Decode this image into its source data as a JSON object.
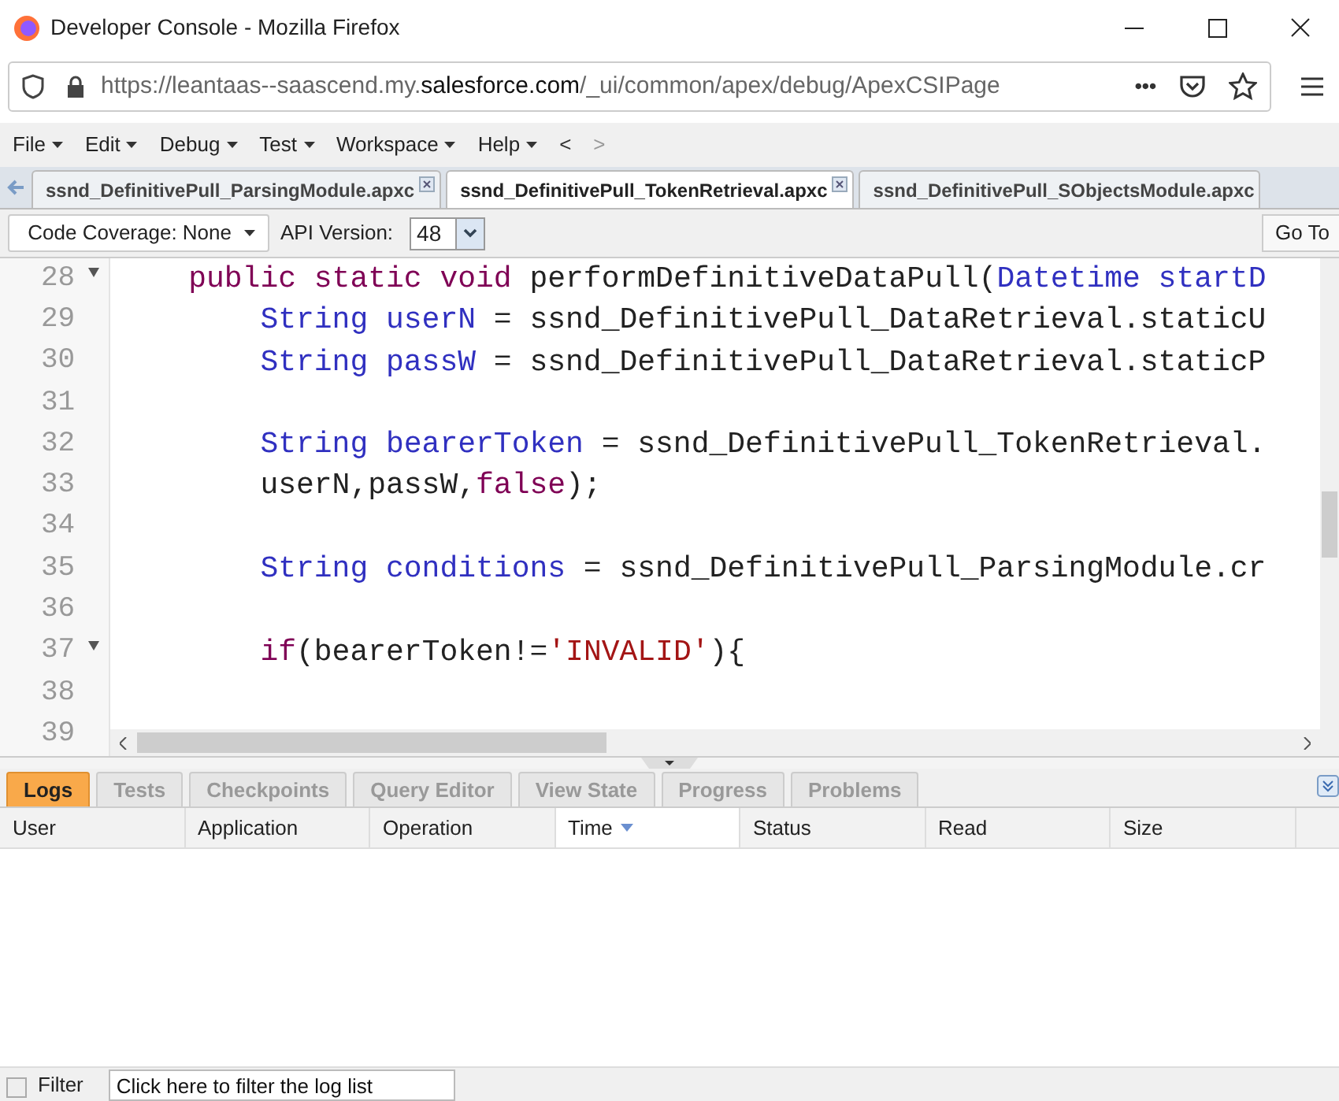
{
  "window": {
    "title": "Developer Console - Mozilla Firefox"
  },
  "address_bar": {
    "url_prefix": "https://leantaas--saascend.my.",
    "url_domain": "salesforce.com",
    "url_path": "/_ui/common/apex/debug/ApexCSIPage",
    "more": "•••"
  },
  "menu": [
    {
      "label": "File"
    },
    {
      "label": "Edit"
    },
    {
      "label": "Debug"
    },
    {
      "label": "Test"
    },
    {
      "label": "Workspace"
    },
    {
      "label": "Help"
    }
  ],
  "nav": [
    "<",
    ">"
  ],
  "file_tabs": [
    {
      "label": "ssnd_DefinitivePull_ParsingModule.apxc",
      "selected": false,
      "closable": true
    },
    {
      "label": "ssnd_DefinitivePull_TokenRetrieval.apxc",
      "selected": true,
      "closable": true
    },
    {
      "label": "ssnd_DefinitivePull_SObjectsModule.apxc",
      "selected": false,
      "closable": false
    }
  ],
  "toolbar": {
    "coverage": "Code Coverage: None",
    "api_label": "API Version:",
    "api_value": "48",
    "goto": "Go To"
  },
  "code_lines": [
    {
      "number": "28",
      "fold": true,
      "kind": "member",
      "tokens": [
        {
          "kind": "keyword",
          "text": "public static void"
        },
        {
          "kind": "plain",
          "text": " performDefinitiveDataPull("
        },
        {
          "kind": "type",
          "text": "Datetime startD"
        }
      ]
    },
    {
      "number": "29",
      "fold": false,
      "kind": "body",
      "tokens": [
        {
          "kind": "type",
          "text": "String userN"
        },
        {
          "kind": "plain",
          "text": " = ssnd_DefinitivePull_DataRetrieval.staticU"
        }
      ]
    },
    {
      "number": "30",
      "fold": false,
      "kind": "body",
      "tokens": [
        {
          "kind": "type",
          "text": "String passW"
        },
        {
          "kind": "plain",
          "text": " = ssnd_DefinitivePull_DataRetrieval.staticP"
        }
      ]
    },
    {
      "number": "31",
      "fold": false
    },
    {
      "number": "32",
      "fold": false,
      "kind": "body",
      "tokens": [
        {
          "kind": "type",
          "text": "String bearerToken"
        },
        {
          "kind": "plain",
          "text": " = ssnd_DefinitivePull_TokenRetrieval."
        }
      ]
    },
    {
      "number": "33",
      "fold": false,
      "kind": "body",
      "tokens": [
        {
          "kind": "plain",
          "text": "userN,passW,"
        },
        {
          "kind": "keyword",
          "text": "false"
        },
        {
          "kind": "plain",
          "text": ");"
        }
      ]
    },
    {
      "number": "34",
      "fold": false
    },
    {
      "number": "35",
      "fold": false,
      "kind": "body",
      "tokens": [
        {
          "kind": "type",
          "text": "String conditions"
        },
        {
          "kind": "plain",
          "text": " = ssnd_DefinitivePull_ParsingModule.cr"
        }
      ]
    },
    {
      "number": "36",
      "fold": false
    },
    {
      "number": "37",
      "fold": true,
      "kind": "body",
      "tokens": [
        {
          "kind": "keyword",
          "text": "if"
        },
        {
          "kind": "plain",
          "text": "(bearerToken!="
        },
        {
          "kind": "string",
          "text": "'INVALID'"
        },
        {
          "kind": "plain",
          "text": "){"
        }
      ]
    },
    {
      "number": "38",
      "fold": false
    },
    {
      "number": "39",
      "fold": false
    }
  ],
  "panel_tabs": [
    {
      "label": "Logs",
      "selected": true
    },
    {
      "label": "Tests",
      "selected": false
    },
    {
      "label": "Checkpoints",
      "selected": false
    },
    {
      "label": "Query Editor",
      "selected": false
    },
    {
      "label": "View State",
      "selected": false
    },
    {
      "label": "Progress",
      "selected": false
    },
    {
      "label": "Problems",
      "selected": false
    }
  ],
  "log_table": {
    "columns": [
      {
        "label": "User",
        "sorted": false
      },
      {
        "label": "Application",
        "sorted": false
      },
      {
        "label": "Operation",
        "sorted": false
      },
      {
        "label": "Time",
        "sorted": true
      },
      {
        "label": "Status",
        "sorted": false
      },
      {
        "label": "Read",
        "sorted": false
      },
      {
        "label": "Size",
        "sorted": false
      }
    ]
  },
  "filter": {
    "label": "Filter",
    "checked": false,
    "placeholder": "Click here to filter the log list"
  }
}
